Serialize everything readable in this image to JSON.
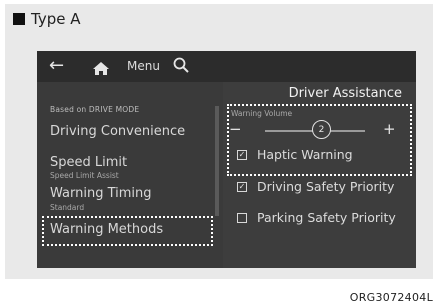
{
  "figure": {
    "type_label": "Type A",
    "code": "ORG3072404L"
  },
  "topbar": {
    "back_icon": "arrow-left-icon",
    "home_icon": "home-icon",
    "menu_label": "Menu",
    "search_icon": "search-icon"
  },
  "left_panel": {
    "based_on": "Based on DRIVE MODE",
    "items": [
      {
        "label": "Driving Convenience",
        "sub": ""
      },
      {
        "label": "Speed Limit",
        "sub": "Speed Limit Assist"
      },
      {
        "label": "Warning Timing",
        "sub": "Standard"
      },
      {
        "label": "Warning Methods",
        "sub": ""
      }
    ]
  },
  "right_panel": {
    "title": "Driver Assistance",
    "warning_volume": {
      "label": "Warning Volume",
      "value": "2",
      "minus": "−",
      "plus": "+"
    },
    "options": [
      {
        "label": "Haptic Warning",
        "checked": true
      },
      {
        "label": "Driving Safety Priority",
        "checked": true
      },
      {
        "label": "Parking Safety Priority",
        "checked": false
      }
    ]
  }
}
